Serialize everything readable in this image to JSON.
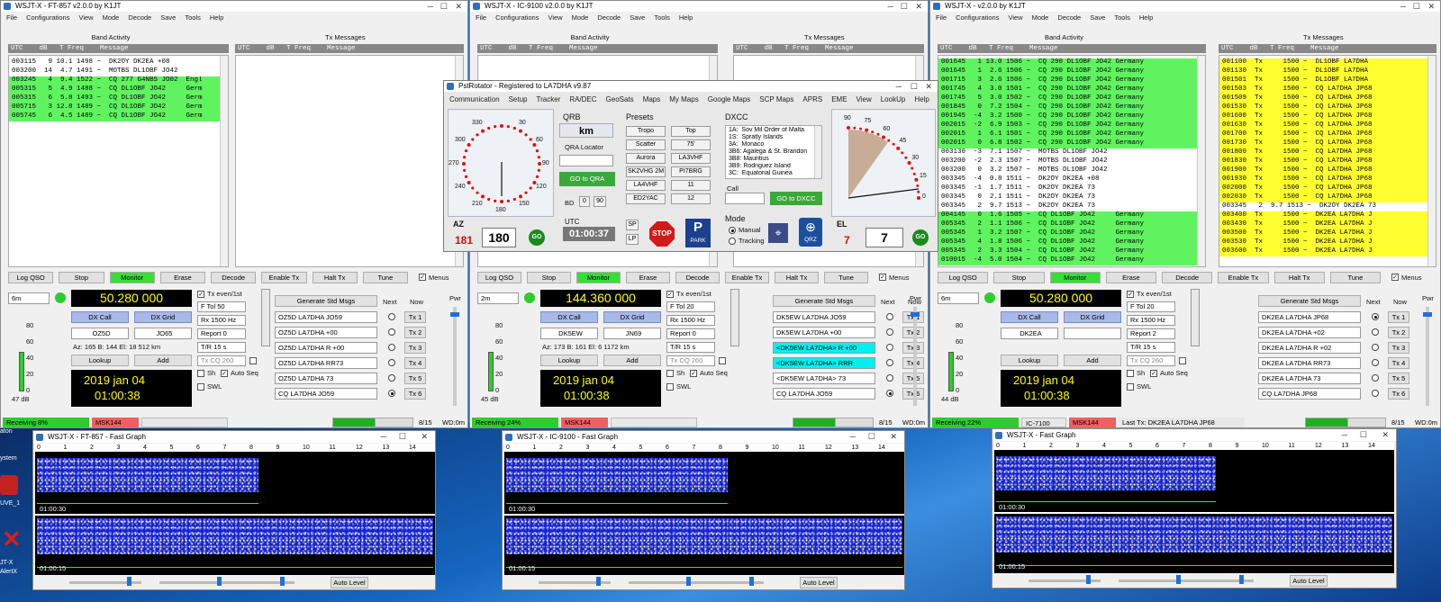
{
  "desktop": {
    "icons": [
      "aton",
      "ystem",
      "UVE_1",
      "JT-X",
      "AlertX"
    ]
  },
  "w1": {
    "title": "WSJT-X - FT-857 v2.0.0 by K1JT",
    "menu": [
      "File",
      "Configurations",
      "View",
      "Mode",
      "Decode",
      "Save",
      "Tools",
      "Help"
    ],
    "band_label": "Band Activity",
    "tx_label": "Tx Messages",
    "hdr": "UTC    dB   T Freq    Message",
    "rows": [
      {
        "t": "003115   9 10.1 1498 ~  DK2OY DK2EA +08",
        "c": ""
      },
      {
        "t": "003200  14  4.7 1491 ~  MOTBS DL1OBF JO42",
        "c": ""
      },
      {
        "t": "003245   4  9.4 1522 ~  CQ 277 G4NBS JO02  Engl",
        "c": "g"
      },
      {
        "t": "005315   5  4.9 1488 ~  CQ DL1OBF JO42     Germ",
        "c": "g"
      },
      {
        "t": "005315   6  5.8 1493 ~  CQ DL1OBF JO42     Germ",
        "c": "g"
      },
      {
        "t": "005715   3 12.8 1489 ~  CQ DL1OBF JO42     Germ",
        "c": "g"
      },
      {
        "t": "005745   6  4.5 1489 ~  CQ DL1OBF JO42     Germ",
        "c": "g"
      }
    ],
    "tx_rows": [],
    "buttons": [
      "Log QSO",
      "Stop",
      "Monitor",
      "Erase",
      "Decode",
      "Enable Tx",
      "Halt Tx",
      "Tune"
    ],
    "menus_label": "Menus",
    "band": "6m",
    "freq": "50.280 000",
    "txeven": "Tx even/1st",
    "dxcall_lbl": "DX Call",
    "dxgrid_lbl": "DX Grid",
    "dxcall": "OZ5D",
    "dxgrid": "JO65",
    "azinfo": "Az: 165  B: 144  El: 18   512 km",
    "lookup": "Lookup",
    "add": "Add",
    "ftol": "F Tol  50",
    "rx": "Rx  1500 Hz",
    "report": "Report  0",
    "tr": "T/R  15 s",
    "txcq": "Tx CQ 260",
    "sh": "Sh",
    "autoseq": "Auto Seq",
    "swl": "SWL",
    "date": "2019 jan 04",
    "time": "01:00:38",
    "db": "47 dB",
    "gen": "Generate Std Msgs",
    "next": "Next",
    "now": "Now",
    "msgs": [
      "OZ5D LA7DHA JO59",
      "OZ5D LA7DHA +00",
      "OZ5D LA7DHA R +00",
      "OZ5D LA7DHA RR73",
      "OZ5D LA7DHA 73",
      "CQ LA7DHA JO59"
    ],
    "txbtn": [
      "Tx 1",
      "Tx 2",
      "Tx 3",
      "Tx 4",
      "Tx 5",
      "Tx 6"
    ],
    "sel": 5,
    "status_rx": "Receiving   8%",
    "mode": "MSK144",
    "count": "8/15",
    "wd": "WD:0m",
    "pwr": "Pwr",
    "scale": [
      "80",
      "60",
      "40",
      "20",
      "0"
    ]
  },
  "w2": {
    "title": "WSJT-X - IC-9100 v2.0.0 by K1JT",
    "menu": [
      "File",
      "Configurations",
      "View",
      "Mode",
      "Decode",
      "Save",
      "Tools",
      "Help"
    ],
    "band_label": "Band Activity",
    "tx_label": "Tx Messages",
    "hdr": "UTC    dB   T Freq    Message",
    "buttons": [
      "Log QSO",
      "Stop",
      "Monitor",
      "Erase",
      "Decode",
      "Enable Tx",
      "Halt Tx",
      "Tune"
    ],
    "menus_label": "Menus",
    "band": "2m",
    "freq": "144.360 000",
    "txeven": "Tx even/1st",
    "dxcall_lbl": "DX Call",
    "dxgrid_lbl": "DX Grid",
    "dxcall": "DK5EW",
    "dxgrid": "JN69",
    "azinfo": "Az: 173  B: 161  El: 6   1172 km",
    "lookup": "Lookup",
    "add": "Add",
    "ftol": "F Tol  20",
    "rx": "Rx  1500 Hz",
    "report": "Report  0",
    "tr": "T/R  15 s",
    "txcq": "Tx CQ 260",
    "sh": "Sh",
    "autoseq": "Auto Seq",
    "swl": "SWL",
    "date": "2019 jan 04",
    "time": "01:00:38",
    "db": "45 dB",
    "gen": "Generate Std Msgs",
    "next": "Next",
    "now": "Now",
    "msgs": [
      "DK5EW LA7DHA JO59",
      "DK5EW LA7DHA +00",
      "<DK5EW LA7DHA> R +00",
      "<DK5EW LA7DHA> RRR",
      "<DK5EW LA7DHA> 73",
      "CQ LA7DHA JO59"
    ],
    "txbtn": [
      "Tx 1",
      "Tx 2",
      "Tx 3",
      "Tx 4",
      "Tx 5",
      "Tx 6"
    ],
    "sel": 5,
    "status_rx": "Receiving   24%",
    "mode": "MSK144",
    "count": "8/15",
    "wd": "WD:0m",
    "pwr": "Pwr",
    "scale": [
      "80",
      "60",
      "40",
      "20",
      "0"
    ]
  },
  "w3": {
    "title": "WSJT-X - v2.0.0 by K1JT",
    "menu": [
      "File",
      "Configurations",
      "View",
      "Mode",
      "Decode",
      "Save",
      "Tools",
      "Help"
    ],
    "band_label": "Band Activity",
    "tx_label": "Tx Messages",
    "hdr": "UTC    dB   T Freq    Message",
    "rows": [
      {
        "t": "001645   1 13.0 1506 ~  CQ 290 DL1OBF JO42 Germany",
        "c": "g"
      },
      {
        "t": "001645   1  2.6 1506 ~  CQ 290 DL1OBF JO42 Germany",
        "c": "g"
      },
      {
        "t": "001715   3  2.6 1506 ~  CQ 290 DL1OBF JO42 Germany",
        "c": "g"
      },
      {
        "t": "001745   4  3.0 1501 ~  CQ 290 DL1OBF JO42 Germany",
        "c": "g"
      },
      {
        "t": "001745   5  3.0 1502 ~  CQ 290 DL1OBF JO42 Germany",
        "c": "g"
      },
      {
        "t": "001845   0  7.2 1504 ~  CQ 290 DL1OBF JO42 Germany",
        "c": "g"
      },
      {
        "t": "001945  -4  3.2 1500 ~  CQ 290 DL1OBF JO42 Germany",
        "c": "g"
      },
      {
        "t": "002015  -2  6.9 1503 ~  CQ 290 DL1OBF JO42 Germany",
        "c": "g"
      },
      {
        "t": "002015   1  6.1 1501 ~  CQ 290 DL1OBF JO42 Germany",
        "c": "g"
      },
      {
        "t": "002015   0  6.8 1502 ~  CQ 290 DL1OBF JO42 Germany",
        "c": "g"
      },
      {
        "t": "003130  -3  7.1 1507 ~  MOTBS DL1OBF JO42",
        "c": ""
      },
      {
        "t": "003200  -2  2.3 1507 ~  MOTBS DL1OBF JO42",
        "c": ""
      },
      {
        "t": "003200   0  3.2 1507 ~  MOTBS DL1OBF JO42",
        "c": ""
      },
      {
        "t": "003345  -4  0.8 1511 ~  DK2OY DK2EA +08",
        "c": ""
      },
      {
        "t": "003345  -1  1.7 1511 ~  DK2OY DK2EA 73",
        "c": ""
      },
      {
        "t": "003345   0  2.1 1511 ~  DK2OY DK2EA 73",
        "c": ""
      },
      {
        "t": "003345   2  9.7 1513 ~  DK2OY DK2EA 73",
        "c": ""
      },
      {
        "t": "004145   0  1.6 1505 ~  CQ DL1OBF JO42     Germany",
        "c": "g"
      },
      {
        "t": "005345   2  1.1 1506 ~  CQ DL1OBF JO42     Germany",
        "c": "g"
      },
      {
        "t": "005345   1  3.2 1507 ~  CQ DL1OBF JO42     Germany",
        "c": "g"
      },
      {
        "t": "005345   4  1.8 1506 ~  CQ DL1OBF JO42     Germany",
        "c": "g"
      },
      {
        "t": "005345   2  3.3 1504 ~  CQ DL1OBF JO42     Germany",
        "c": "g"
      },
      {
        "t": "010015  -4  5.0 1504 ~  CQ DL1OBF JO42     Germany",
        "c": "g"
      }
    ],
    "tx_rows": [
      {
        "t": "001100  Tx     1500 ~  DL1OBF LA7DHA",
        "c": "y"
      },
      {
        "t": "001130  Tx     1500 ~  DL1OBF LA7DHA",
        "c": "y"
      },
      {
        "t": "001501  Tx     1500 ~  DL1OBF LA7DHA",
        "c": "y"
      },
      {
        "t": "001503  Tx     1500 ~  CQ LA7DHA JP68",
        "c": "y"
      },
      {
        "t": "001509  Tx     1500 ~  CQ LA7DHA JP68",
        "c": "y"
      },
      {
        "t": "001530  Tx     1500 ~  CQ LA7DHA JP68",
        "c": "y"
      },
      {
        "t": "001600  Tx     1500 ~  CQ LA7DHA JP68",
        "c": "y"
      },
      {
        "t": "001630  Tx     1500 ~  CQ LA7DHA JP68",
        "c": "y"
      },
      {
        "t": "001700  Tx     1500 ~  CQ LA7DHA JP68",
        "c": "y"
      },
      {
        "t": "001730  Tx     1500 ~  CQ LA7DHA JP68",
        "c": "y"
      },
      {
        "t": "001800  Tx     1500 ~  CQ LA7DHA JP68",
        "c": "y"
      },
      {
        "t": "001830  Tx     1500 ~  CQ LA7DHA JP68",
        "c": "y"
      },
      {
        "t": "001900  Tx     1500 ~  CQ LA7DHA JP68",
        "c": "y"
      },
      {
        "t": "001930  Tx     1500 ~  CQ LA7DHA JP68",
        "c": "y"
      },
      {
        "t": "002000  Tx     1500 ~  CQ LA7DHA JP68",
        "c": "y"
      },
      {
        "t": "002030  Tx     1500 ~  CQ LA7DHA JP68",
        "c": "y"
      },
      {
        "t": "003345   2  9.7 1513 ~  DK2OY DK2EA 73",
        "c": ""
      },
      {
        "t": "003400  Tx     1500 ~  DK2EA LA7DHA J",
        "c": "y"
      },
      {
        "t": "003430  Tx     1500 ~  DK2EA LA7DHA J",
        "c": "y"
      },
      {
        "t": "003500  Tx     1500 ~  DK2EA LA7DHA J",
        "c": "y"
      },
      {
        "t": "003530  Tx     1500 ~  DK2EA LA7DHA J",
        "c": "y"
      },
      {
        "t": "003600  Tx     1500 ~  DK2EA LA7DHA J",
        "c": "y"
      }
    ],
    "buttons": [
      "Log QSO",
      "Stop",
      "Monitor",
      "Erase",
      "Decode",
      "Enable Tx",
      "Halt Tx",
      "Tune"
    ],
    "menus_label": "Menus",
    "band": "6m",
    "freq": "50.280 000",
    "txeven": "Tx even/1st",
    "dxcall_lbl": "DX Call",
    "dxgrid_lbl": "DX Grid",
    "dxcall": "DK2EA",
    "dxgrid": "",
    "azinfo": "",
    "lookup": "Lookup",
    "add": "Add",
    "ftol": "F Tol  20",
    "rx": "Rx  1500 Hz",
    "report": "Report  2",
    "tr": "T/R  15 s",
    "txcq": "Tx CQ 260",
    "sh": "Sh",
    "autoseq": "Auto Seq",
    "swl": "SWL",
    "date": "2019 jan 04",
    "time": "01:00:38",
    "db": "44 dB",
    "gen": "Generate Std Msgs",
    "next": "Next",
    "now": "Now",
    "msgs": [
      "DK2EA LA7DHA JP68",
      "DK2EA LA7DHA +02",
      "DK2EA LA7DHA R +02",
      "DK2EA LA7DHA RR73",
      "DK2EA LA7DHA 73",
      "CQ LA7DHA JP68"
    ],
    "txbtn": [
      "Tx 1",
      "Tx 2",
      "Tx 3",
      "Tx 4",
      "Tx 5",
      "Tx 6"
    ],
    "sel": 0,
    "status_rx": "Receiving   22%",
    "rig": "IC-7100",
    "mode": "MSK144",
    "lasttx": "Last Tx: DK2EA LA7DHA JP68",
    "count": "8/15",
    "wd": "WD:0m",
    "pwr": "Pwr",
    "scale": [
      "80",
      "60",
      "40",
      "20",
      "0"
    ]
  },
  "fg1": {
    "title": "WSJT-X - FT-857 - Fast Graph",
    "t1": "01:00:30",
    "t2": "01:00:15",
    "auto": "Auto Level"
  },
  "fg2": {
    "title": "WSJT-X - IC-9100 - Fast Graph",
    "t1": "01:00:30",
    "t2": "01:00:15",
    "auto": "Auto Level"
  },
  "fg3": {
    "title": "WSJT-X - Fast Graph",
    "t1": "01:00:30",
    "t2": "01:00:15",
    "auto": "Auto Level"
  },
  "fg_ticks": [
    "0",
    "1",
    "2",
    "3",
    "4",
    "5",
    "6",
    "7",
    "8",
    "9",
    "10",
    "11",
    "12",
    "13",
    "14"
  ],
  "rot": {
    "title": "PstRotator - Registered to LA7DHA   v9.87",
    "menu": [
      "Communication",
      "Setup",
      "Tracker",
      "RA/DEC",
      "GeoSats",
      "Maps",
      "My Maps",
      "Google Maps",
      "SCP Maps",
      "APRS",
      "EME",
      "View",
      "LookUp",
      "Help"
    ],
    "compass": [
      "330",
      "30",
      "300",
      "60",
      "270",
      "90",
      "240",
      "120",
      "210",
      "150",
      "180"
    ],
    "az_label": "AZ",
    "az_set": "181",
    "az_val": "180",
    "go": "GO",
    "qrb": "QRB",
    "km": "km",
    "qra": "QRA Locator",
    "gotoqra": "GO to QRA",
    "bd": "BD",
    "bd0": "0",
    "bd90": "90",
    "utc": "UTC",
    "utc_val": "01:00:37",
    "presets_label": "Presets",
    "presets": [
      "Tropo",
      "Top",
      "Scatter",
      "75'",
      "Aurora",
      "LA3VHF",
      "SK2VHG 2M",
      "PI7BRG",
      "LA4VHF",
      "11",
      "ED2YAC",
      "12"
    ],
    "sp": "SP",
    "lp": "LP",
    "stop": "STOP",
    "park": "PARK",
    "dxcc_label": "DXCC",
    "dxcc": [
      "1A:  Sov Mil Order of Malta",
      "1S:  Spratly Islands",
      "3A:  Monaco",
      "3B6: Agalega & St. Brandon",
      "3B8: Mauritius",
      "3B9: Rodriguez Island",
      "3C:  Equatorial Guinea"
    ],
    "call": "Call",
    "gotodxcc": "GO to DXCC",
    "mode_label": "Mode",
    "manual": "Manual",
    "tracking": "Tracking",
    "qrz": "QRZ",
    "el_scale": [
      "90",
      "75",
      "60",
      "45",
      "30",
      "15",
      "0"
    ],
    "el_label": "EL",
    "el_set": "7",
    "el_val": "7"
  }
}
